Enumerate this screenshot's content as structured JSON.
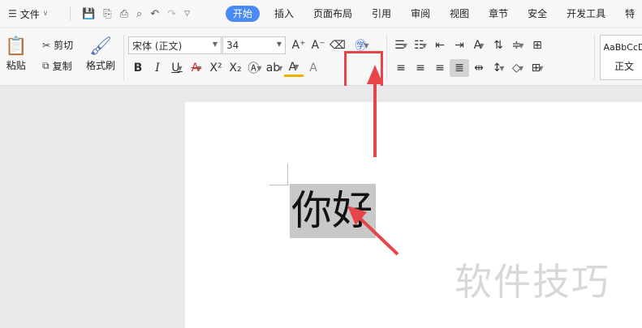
{
  "menubar": {
    "file_label": "文件",
    "tabs": [
      "开始",
      "插入",
      "页面布局",
      "引用",
      "审阅",
      "视图",
      "章节",
      "安全",
      "开发工具",
      "特"
    ]
  },
  "clipboard": {
    "paste": "粘贴",
    "cut": "剪切",
    "copy": "复制",
    "format_painter": "格式刷"
  },
  "font": {
    "name": "宋体 (正文)",
    "size": "34"
  },
  "styles": {
    "preview": "AaBbCcD",
    "normal": "正文"
  },
  "document": {
    "selected_text": "你好",
    "watermark": "软件技巧"
  },
  "colors": {
    "accent": "#4b8af5",
    "annotation": "#e64649"
  }
}
